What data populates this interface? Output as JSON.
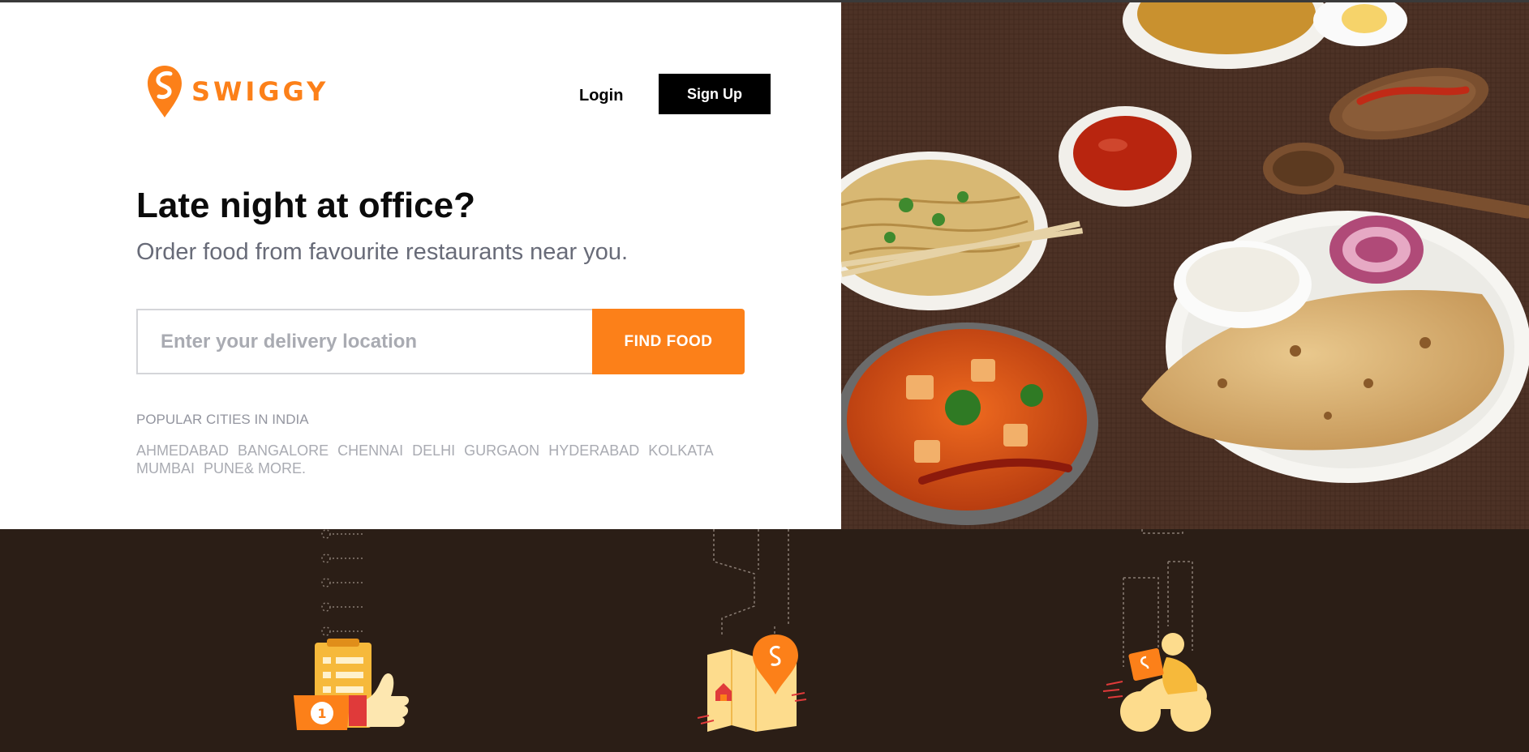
{
  "brand": {
    "name": "SWIGGY",
    "color": "#fc8019"
  },
  "header": {
    "login_label": "Login",
    "signup_label": "Sign Up"
  },
  "hero": {
    "title": "Late night at office?",
    "subtitle": "Order food from favourite restaurants near you."
  },
  "search": {
    "placeholder": "Enter your delivery location",
    "value": "",
    "button_label": "FIND FOOD"
  },
  "popular": {
    "heading": "POPULAR CITIES IN INDIA",
    "cities": [
      "AHMEDABAD",
      "BANGALORE",
      "CHENNAI",
      "DELHI",
      "GURGAON",
      "HYDERABAD",
      "KOLKATA",
      "MUMBAI",
      "PUNE"
    ],
    "more_label": "& MORE."
  },
  "icons": {
    "logo": "swiggy-pin-icon",
    "features": [
      "order-thumbs-up-icon",
      "map-location-pin-icon",
      "delivery-scooter-icon"
    ]
  },
  "colors": {
    "accent": "#fc8019",
    "footer_band": "#2b1e16",
    "food_background": "#4a2f22"
  }
}
